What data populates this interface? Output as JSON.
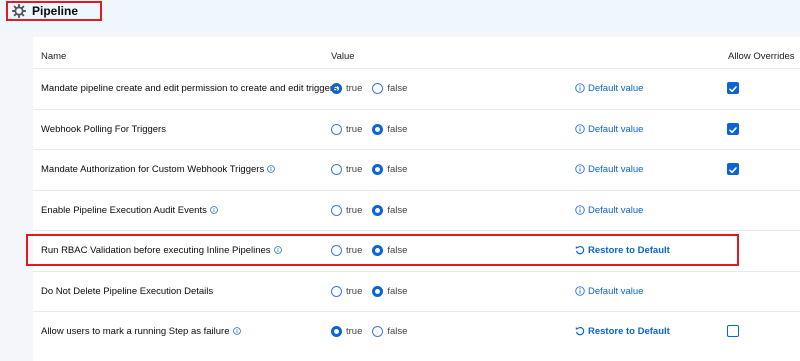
{
  "section": {
    "title": "Pipeline"
  },
  "columns": {
    "name": "Name",
    "value": "Value",
    "overrides": "Allow Overrides"
  },
  "rows": [
    {
      "name": "Mandate pipeline create and edit permission to create and edit triggers",
      "info": false,
      "value": "true",
      "true_label": "true",
      "false_label": "false",
      "action": "Default value",
      "action_type": "default",
      "override": "checked"
    },
    {
      "name": "Webhook Polling For Triggers",
      "info": false,
      "value": "false",
      "true_label": "true",
      "false_label": "false",
      "action": "Default value",
      "action_type": "default",
      "override": "checked"
    },
    {
      "name": "Mandate Authorization for Custom Webhook Triggers",
      "info": true,
      "value": "false",
      "true_label": "true",
      "false_label": "false",
      "action": "Default value",
      "action_type": "default",
      "override": "checked"
    },
    {
      "name": "Enable Pipeline Execution Audit Events",
      "info": true,
      "value": "false",
      "true_label": "true",
      "false_label": "false",
      "action": "Default value",
      "action_type": "default",
      "override": "none"
    },
    {
      "name": "Run RBAC Validation before executing Inline Pipelines",
      "info": true,
      "value": "false",
      "true_label": "true",
      "false_label": "false",
      "action": "Restore to Default",
      "action_type": "restore",
      "override": "none"
    },
    {
      "name": "Do Not Delete Pipeline Execution Details",
      "info": false,
      "value": "false",
      "true_label": "true",
      "false_label": "false",
      "action": "Default value",
      "action_type": "default",
      "override": "none"
    },
    {
      "name": "Allow users to mark a running Step as failure",
      "info": true,
      "value": "true",
      "true_label": "true",
      "false_label": "false",
      "action": "Restore to Default",
      "action_type": "restore",
      "override": "unchecked"
    }
  ],
  "colors": {
    "accent": "#0a64d6",
    "highlight": "#e01b24",
    "header_bg": "#eef7fc"
  }
}
